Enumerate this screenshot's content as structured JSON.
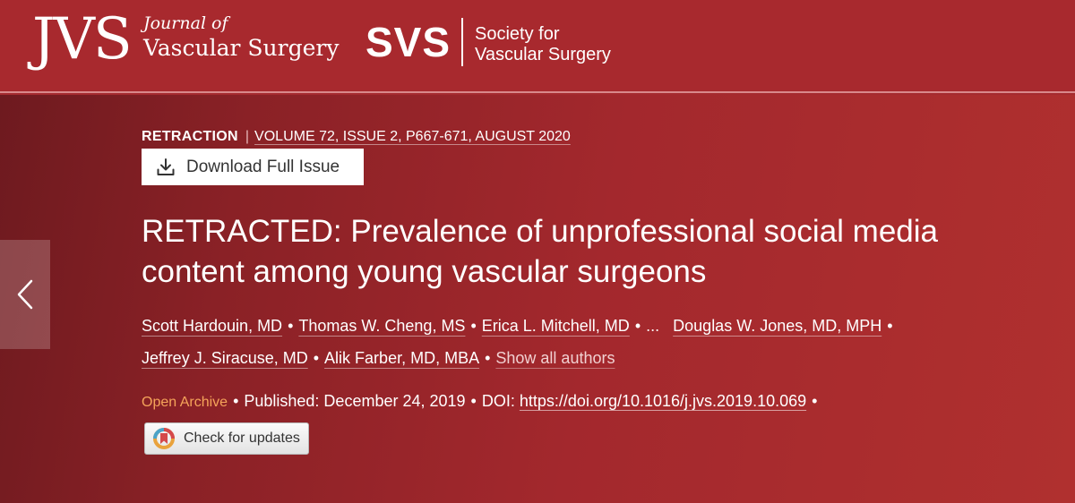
{
  "header": {
    "jvs_logo": "JVS",
    "jvs_name_line1": "Journal of",
    "jvs_name_line2": "Vascular Surgery",
    "svs_logo": "SVS",
    "svs_name_line1": "Society for",
    "svs_name_line2": "Vascular Surgery"
  },
  "article": {
    "type": "RETRACTION",
    "separator": "|",
    "volume_info": "VOLUME 72, ISSUE 2, P667-671, AUGUST 2020",
    "download_label": "Download Full Issue",
    "title": "RETRACTED: Prevalence of unprofessional social media content among young vascular surgeons",
    "authors": [
      "Scott Hardouin, MD",
      "Thomas W. Cheng, MS",
      "Erica L. Mitchell, MD",
      "Douglas W. Jones, MD, MPH",
      "Jeffrey J. Siracuse, MD",
      "Alik Farber, MD, MBA"
    ],
    "ellipsis": "...",
    "show_all_authors": "Show all authors",
    "access": "Open Archive",
    "published": "Published: December 24, 2019",
    "doi_prefix": "DOI:",
    "doi_url": "https://doi.org/10.1016/j.jvs.2019.10.069",
    "check_updates": "Check for updates"
  },
  "icons": {
    "prev": "chevron-left-icon",
    "download": "download-icon",
    "crossmark": "crossmark-icon"
  },
  "colors": {
    "header_bg": "#a8292e",
    "hero_dark": "#6e1a1f",
    "hero_light": "#b0302f",
    "open_archive": "#f5a45a"
  }
}
